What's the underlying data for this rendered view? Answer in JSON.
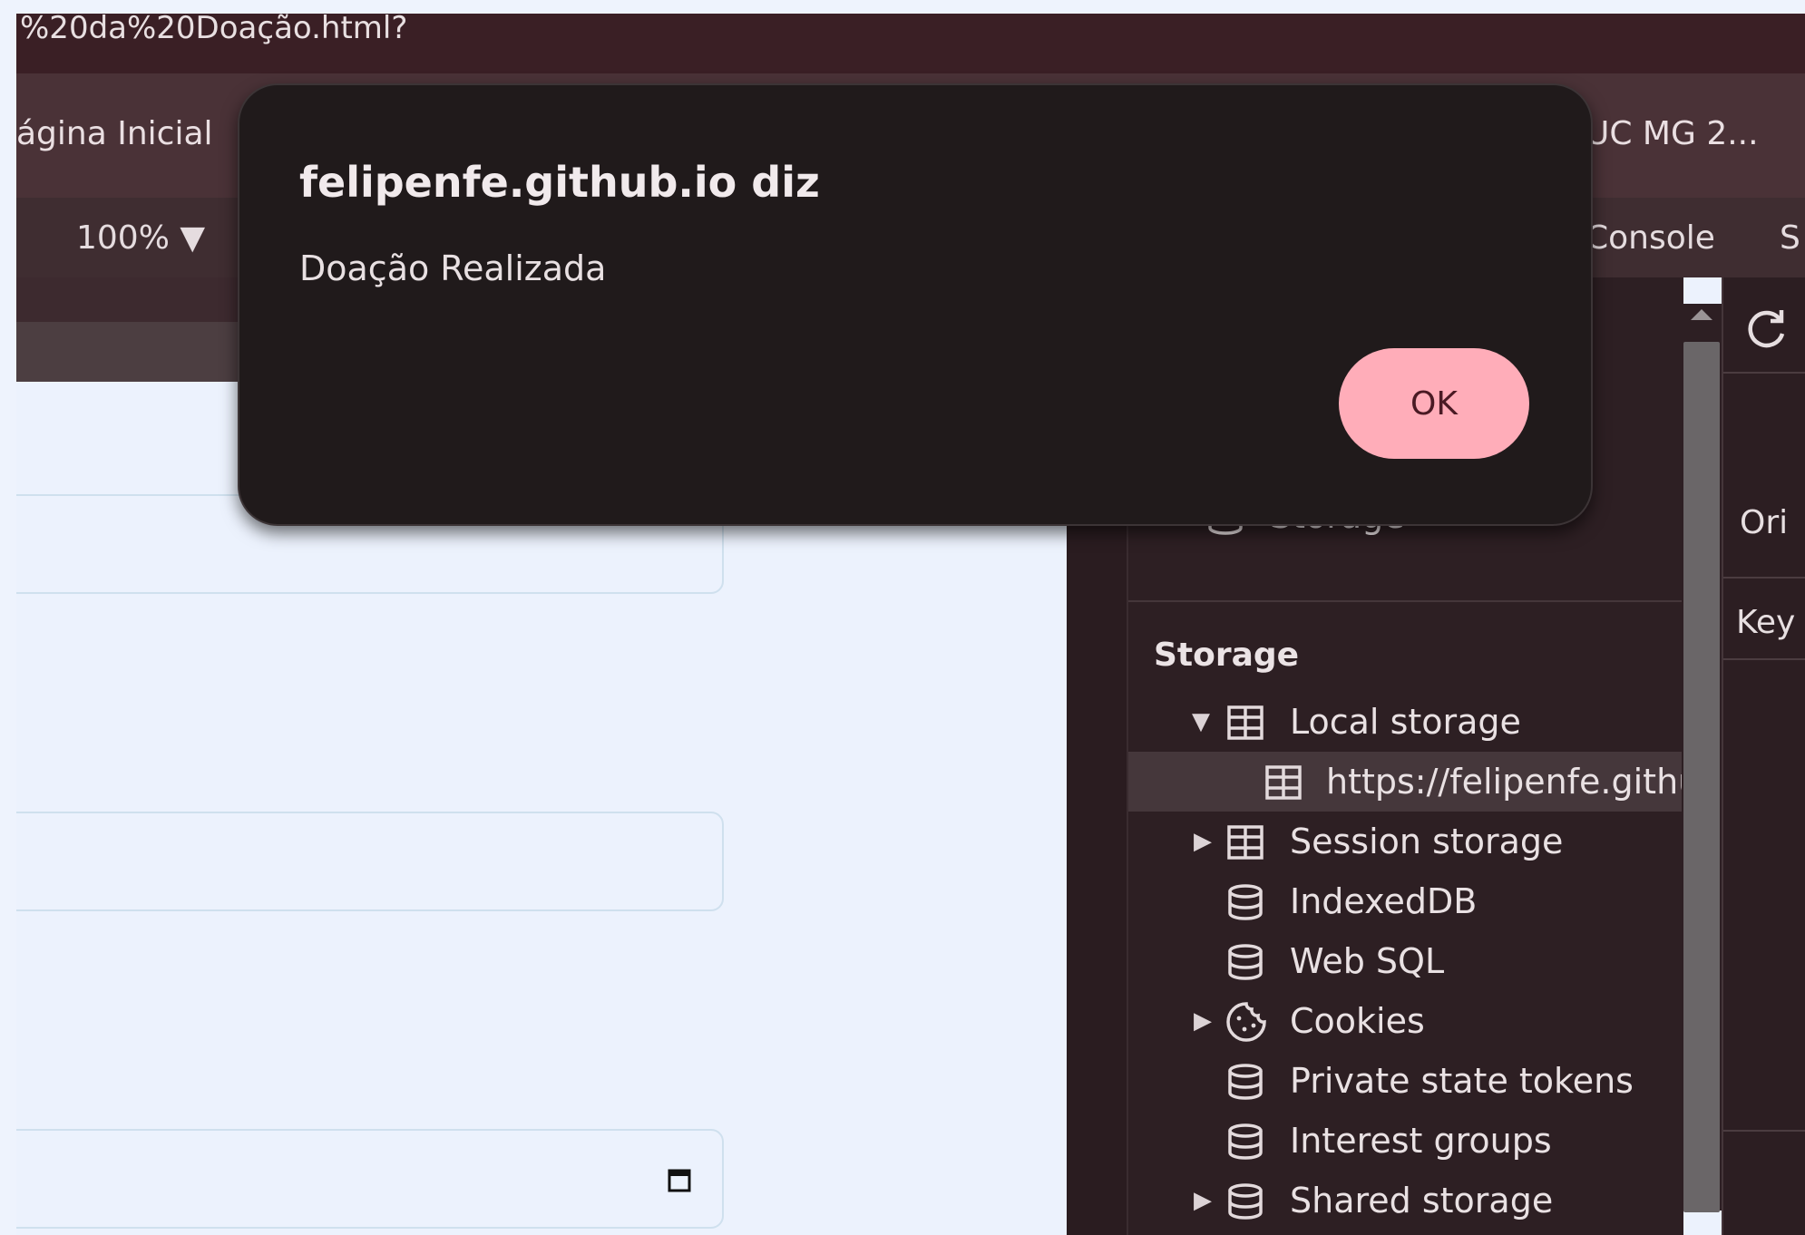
{
  "address_bar": {
    "url_fragment": "%20da%20Doação.html?"
  },
  "bookmarks": {
    "left_item": "ágina Inicial",
    "right_item": "UC MG 2..."
  },
  "devtools": {
    "zoom": "100% ▼",
    "tab_console": "Console",
    "tab_partial": "S",
    "storage_partial_label": "Storage",
    "section_title": "Storage",
    "tree_items": [
      {
        "label": "Local storage",
        "expanded": true,
        "icon": "table-icon"
      },
      {
        "label": "https://felipenfe.github",
        "selected": true,
        "icon": "table-icon"
      },
      {
        "label": "Session storage",
        "collapsed": true,
        "icon": "table-icon"
      },
      {
        "label": "IndexedDB",
        "icon": "database-icon"
      },
      {
        "label": "Web SQL",
        "icon": "database-icon"
      },
      {
        "label": "Cookies",
        "collapsed": true,
        "icon": "cookie-icon"
      },
      {
        "label": "Private state tokens",
        "icon": "database-icon"
      },
      {
        "label": "Interest groups",
        "icon": "database-icon"
      },
      {
        "label": "Shared storage",
        "collapsed": true,
        "icon": "database-icon"
      }
    ],
    "right_pane": {
      "origin_partial": "Ori",
      "key_partial": "Key"
    }
  },
  "dialog": {
    "title": "felipenfe.github.io diz",
    "message": "Doação Realizada",
    "ok_label": "OK"
  },
  "colors": {
    "dialog_bg": "#201a1b",
    "ok_button": "#ffadb9",
    "page_bg": "#ecf2fd",
    "devtools_bg": "#2d1f23"
  }
}
